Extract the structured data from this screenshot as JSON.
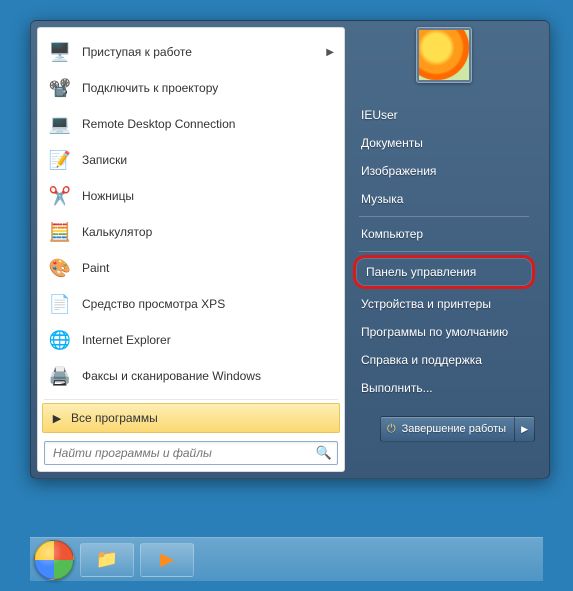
{
  "left": {
    "programs": [
      {
        "icon": "🖥️",
        "label": "Приступая к работе",
        "submenu": true,
        "hint": "getting-started"
      },
      {
        "icon": "📽️",
        "label": "Подключить к проектору",
        "submenu": false,
        "hint": "connect-projector"
      },
      {
        "icon": "💻",
        "label": "Remote Desktop Connection",
        "submenu": false,
        "hint": "remote-desktop"
      },
      {
        "icon": "📝",
        "label": "Записки",
        "submenu": false,
        "hint": "sticky-notes"
      },
      {
        "icon": "✂️",
        "label": "Ножницы",
        "submenu": false,
        "hint": "snipping-tool"
      },
      {
        "icon": "🧮",
        "label": "Калькулятор",
        "submenu": false,
        "hint": "calculator"
      },
      {
        "icon": "🎨",
        "label": "Paint",
        "submenu": false,
        "hint": "paint"
      },
      {
        "icon": "📄",
        "label": "Средство просмотра XPS",
        "submenu": false,
        "hint": "xps-viewer"
      },
      {
        "icon": "🌐",
        "label": "Internet Explorer",
        "submenu": false,
        "hint": "internet-explorer"
      },
      {
        "icon": "🖨️",
        "label": "Факсы и сканирование Windows",
        "submenu": false,
        "hint": "fax-scan"
      }
    ],
    "all_programs": "Все программы",
    "search_placeholder": "Найти программы и файлы"
  },
  "right": {
    "username": "IEUser",
    "items_top": [
      {
        "label": "Документы",
        "hint": "documents"
      },
      {
        "label": "Изображения",
        "hint": "pictures"
      },
      {
        "label": "Музыка",
        "hint": "music"
      }
    ],
    "items_mid": [
      {
        "label": "Компьютер",
        "hint": "computer"
      }
    ],
    "items_low": [
      {
        "label": "Панель управления",
        "hint": "control-panel",
        "highlighted": true
      },
      {
        "label": "Устройства и принтеры",
        "hint": "devices-printers"
      },
      {
        "label": "Программы по умолчанию",
        "hint": "default-programs"
      },
      {
        "label": "Справка и поддержка",
        "hint": "help-support"
      },
      {
        "label": "Выполнить...",
        "hint": "run"
      }
    ],
    "shutdown": "Завершение работы"
  },
  "taskbar": {
    "pins": [
      {
        "icon": "📁",
        "hint": "explorer"
      },
      {
        "icon": "▶",
        "hint": "media-player",
        "color": "#ff8c1a"
      }
    ]
  }
}
